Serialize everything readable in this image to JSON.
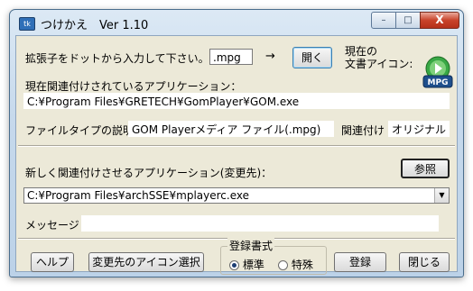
{
  "window": {
    "title": "つけかえ　Ver 1.10",
    "app_icon_label": "tk",
    "close_glyph": "X",
    "min_glyph": "–",
    "max_glyph": "□"
  },
  "ext": {
    "label": "拡張子をドットから入力して下さい。",
    "value": ".mpg",
    "arrow": "→",
    "open_button": "開く"
  },
  "icon_area": {
    "label_line1": "現在の",
    "label_line2": "文書アイコン:",
    "icon_text": "MPG"
  },
  "current_app": {
    "label": "現在関連付けされているアプリケーション：",
    "path": "C:¥Program Files¥GRETECH¥GomPlayer¥GOM.exe"
  },
  "filetype": {
    "label": "ファイルタイプの説明",
    "value": "GOM Playerメディア ファイル(.mpg)",
    "assoc_label": "関連付け",
    "assoc_value": "オリジナル"
  },
  "new_app": {
    "label": "新しく関連付けさせるアプリケーション(変更先)：",
    "browse_button": "参照",
    "path": "C:¥Program Files¥archSSE¥mplayerc.exe",
    "dropdown_glyph": "▼"
  },
  "message": {
    "label": "メッセージ",
    "value": ""
  },
  "footer": {
    "help_button": "ヘルプ",
    "icon_select_button": "変更先のアイコン選択",
    "group_title": "登録書式",
    "radio_standard": "標準",
    "radio_special": "特殊",
    "register_button": "登録",
    "close_button": "閉じる"
  }
}
